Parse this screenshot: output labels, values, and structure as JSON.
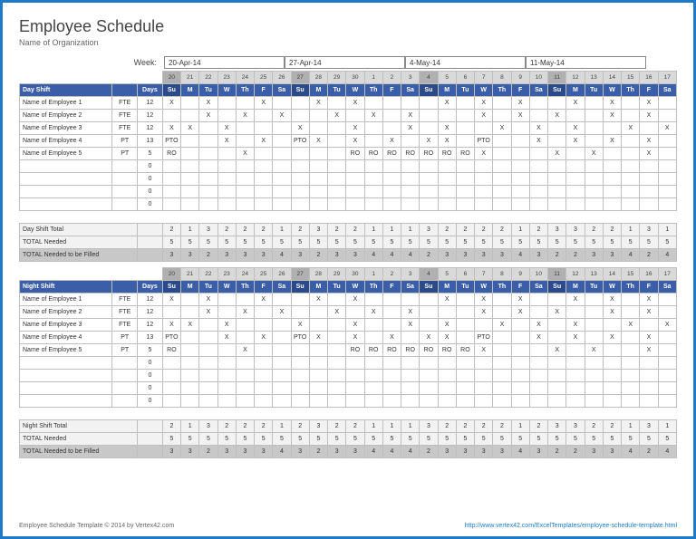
{
  "title": "Employee Schedule",
  "org": "Name of Organization",
  "weekLabel": "Week:",
  "weekStarts": [
    "20-Apr-14",
    "27-Apr-14",
    "4-May-14",
    "11-May-14"
  ],
  "daynums": [
    "20",
    "21",
    "22",
    "23",
    "24",
    "25",
    "26",
    "27",
    "28",
    "29",
    "30",
    "1",
    "2",
    "3",
    "4",
    "5",
    "6",
    "7",
    "8",
    "9",
    "10",
    "11",
    "12",
    "13",
    "14",
    "15",
    "16",
    "17"
  ],
  "dows": [
    "Su",
    "M",
    "Tu",
    "W",
    "Th",
    "F",
    "Sa",
    "Su",
    "M",
    "Tu",
    "W",
    "Th",
    "F",
    "Sa",
    "Su",
    "M",
    "Tu",
    "W",
    "Th",
    "F",
    "Sa",
    "Su",
    "M",
    "Tu",
    "W",
    "Th",
    "F",
    "Sa"
  ],
  "sundayIdx": [
    0,
    7,
    14,
    21
  ],
  "shifts": [
    {
      "name": "Day Shift",
      "daysLabel": "Days",
      "rows": [
        {
          "name": "Name of Employee 1",
          "type": "FTE",
          "days": "12",
          "cells": [
            "X",
            "",
            "X",
            "",
            "",
            "X",
            "",
            "",
            "X",
            "",
            "X",
            "",
            "",
            "",
            "",
            "X",
            "",
            "X",
            "",
            "X",
            "",
            "",
            "X",
            "",
            "X",
            "",
            "X",
            ""
          ]
        },
        {
          "name": "Name of Employee 2",
          "type": "FTE",
          "days": "12",
          "cells": [
            "",
            "",
            "X",
            "",
            "X",
            "",
            "X",
            "",
            "",
            "X",
            "",
            "X",
            "",
            "X",
            "",
            "",
            "",
            "X",
            "",
            "X",
            "",
            "X",
            "",
            "",
            "X",
            "",
            "X",
            ""
          ]
        },
        {
          "name": "Name of Employee 3",
          "type": "FTE",
          "days": "12",
          "cells": [
            "X",
            "X",
            "",
            "X",
            "",
            "",
            "",
            "X",
            "",
            "",
            "X",
            "",
            "",
            "X",
            "",
            "X",
            "",
            "",
            "X",
            "",
            "X",
            "",
            "X",
            "",
            "",
            "X",
            "",
            "X"
          ]
        },
        {
          "name": "Name of Employee 4",
          "type": "PT",
          "days": "13",
          "cells": [
            "PTO",
            "",
            "",
            "X",
            "",
            "X",
            "",
            "PTO",
            "X",
            "",
            "X",
            "",
            "X",
            "",
            "X",
            "X",
            "",
            "PTO",
            "",
            "",
            "X",
            "",
            "X",
            "",
            "X",
            "",
            "X",
            ""
          ]
        },
        {
          "name": "Name of Employee 5",
          "type": "PT",
          "days": "5",
          "cells": [
            "RO",
            "",
            "",
            "",
            "X",
            "",
            "",
            "",
            "",
            "",
            "RO",
            "RO",
            "RO",
            "RO",
            "RO",
            "RO",
            "RO",
            "X",
            "",
            "",
            "",
            "X",
            "",
            "X",
            "",
            "",
            "X",
            ""
          ]
        },
        {
          "name": "",
          "type": "",
          "days": "0",
          "cells": [
            "",
            "",
            "",
            "",
            "",
            "",
            "",
            "",
            "",
            "",
            "",
            "",
            "",
            "",
            "",
            "",
            "",
            "",
            "",
            "",
            "",
            "",
            "",
            "",
            "",
            "",
            "",
            ""
          ]
        },
        {
          "name": "",
          "type": "",
          "days": "0",
          "cells": [
            "",
            "",
            "",
            "",
            "",
            "",
            "",
            "",
            "",
            "",
            "",
            "",
            "",
            "",
            "",
            "",
            "",
            "",
            "",
            "",
            "",
            "",
            "",
            "",
            "",
            "",
            "",
            ""
          ]
        },
        {
          "name": "",
          "type": "",
          "days": "0",
          "cells": [
            "",
            "",
            "",
            "",
            "",
            "",
            "",
            "",
            "",
            "",
            "",
            "",
            "",
            "",
            "",
            "",
            "",
            "",
            "",
            "",
            "",
            "",
            "",
            "",
            "",
            "",
            "",
            ""
          ]
        },
        {
          "name": "",
          "type": "",
          "days": "0",
          "cells": [
            "",
            "",
            "",
            "",
            "",
            "",
            "",
            "",
            "",
            "",
            "",
            "",
            "",
            "",
            "",
            "",
            "",
            "",
            "",
            "",
            "",
            "",
            "",
            "",
            "",
            "",
            "",
            ""
          ]
        }
      ],
      "totals": [
        {
          "label": "Day Shift Total",
          "vals": [
            "2",
            "1",
            "3",
            "2",
            "2",
            "2",
            "1",
            "2",
            "3",
            "2",
            "2",
            "1",
            "1",
            "1",
            "3",
            "2",
            "2",
            "2",
            "2",
            "1",
            "2",
            "3",
            "3",
            "2",
            "2",
            "1",
            "3",
            "1"
          ]
        },
        {
          "label": "TOTAL Needed",
          "vals": [
            "5",
            "5",
            "5",
            "5",
            "5",
            "5",
            "5",
            "5",
            "5",
            "5",
            "5",
            "5",
            "5",
            "5",
            "5",
            "5",
            "5",
            "5",
            "5",
            "5",
            "5",
            "5",
            "5",
            "5",
            "5",
            "5",
            "5",
            "5"
          ]
        },
        {
          "label": "TOTAL Needed to be Filled",
          "vals": [
            "3",
            "3",
            "2",
            "3",
            "3",
            "3",
            "4",
            "3",
            "2",
            "3",
            "3",
            "4",
            "4",
            "4",
            "2",
            "3",
            "3",
            "3",
            "3",
            "4",
            "3",
            "2",
            "2",
            "3",
            "3",
            "4",
            "2",
            "4"
          ],
          "dark": true
        }
      ]
    },
    {
      "name": "Night Shift",
      "daysLabel": "Days",
      "rows": [
        {
          "name": "Name of Employee 1",
          "type": "FTE",
          "days": "12",
          "cells": [
            "X",
            "",
            "X",
            "",
            "",
            "X",
            "",
            "",
            "X",
            "",
            "X",
            "",
            "",
            "",
            "",
            "X",
            "",
            "X",
            "",
            "X",
            "",
            "",
            "X",
            "",
            "X",
            "",
            "X",
            ""
          ]
        },
        {
          "name": "Name of Employee 2",
          "type": "FTE",
          "days": "12",
          "cells": [
            "",
            "",
            "X",
            "",
            "X",
            "",
            "X",
            "",
            "",
            "X",
            "",
            "X",
            "",
            "X",
            "",
            "",
            "",
            "X",
            "",
            "X",
            "",
            "X",
            "",
            "",
            "X",
            "",
            "X",
            ""
          ]
        },
        {
          "name": "Name of Employee 3",
          "type": "FTE",
          "days": "12",
          "cells": [
            "X",
            "X",
            "",
            "X",
            "",
            "",
            "",
            "X",
            "",
            "",
            "X",
            "",
            "",
            "X",
            "",
            "X",
            "",
            "",
            "X",
            "",
            "X",
            "",
            "X",
            "",
            "",
            "X",
            "",
            "X"
          ]
        },
        {
          "name": "Name of Employee 4",
          "type": "PT",
          "days": "13",
          "cells": [
            "PTO",
            "",
            "",
            "X",
            "",
            "X",
            "",
            "PTO",
            "X",
            "",
            "X",
            "",
            "X",
            "",
            "X",
            "X",
            "",
            "PTO",
            "",
            "",
            "X",
            "",
            "X",
            "",
            "X",
            "",
            "X",
            ""
          ]
        },
        {
          "name": "Name of Employee 5",
          "type": "PT",
          "days": "5",
          "cells": [
            "RO",
            "",
            "",
            "",
            "X",
            "",
            "",
            "",
            "",
            "",
            "RO",
            "RO",
            "RO",
            "RO",
            "RO",
            "RO",
            "RO",
            "X",
            "",
            "",
            "",
            "X",
            "",
            "X",
            "",
            "",
            "X",
            ""
          ]
        },
        {
          "name": "",
          "type": "",
          "days": "0",
          "cells": [
            "",
            "",
            "",
            "",
            "",
            "",
            "",
            "",
            "",
            "",
            "",
            "",
            "",
            "",
            "",
            "",
            "",
            "",
            "",
            "",
            "",
            "",
            "",
            "",
            "",
            "",
            "",
            ""
          ]
        },
        {
          "name": "",
          "type": "",
          "days": "0",
          "cells": [
            "",
            "",
            "",
            "",
            "",
            "",
            "",
            "",
            "",
            "",
            "",
            "",
            "",
            "",
            "",
            "",
            "",
            "",
            "",
            "",
            "",
            "",
            "",
            "",
            "",
            "",
            "",
            ""
          ]
        },
        {
          "name": "",
          "type": "",
          "days": "0",
          "cells": [
            "",
            "",
            "",
            "",
            "",
            "",
            "",
            "",
            "",
            "",
            "",
            "",
            "",
            "",
            "",
            "",
            "",
            "",
            "",
            "",
            "",
            "",
            "",
            "",
            "",
            "",
            "",
            ""
          ]
        },
        {
          "name": "",
          "type": "",
          "days": "0",
          "cells": [
            "",
            "",
            "",
            "",
            "",
            "",
            "",
            "",
            "",
            "",
            "",
            "",
            "",
            "",
            "",
            "",
            "",
            "",
            "",
            "",
            "",
            "",
            "",
            "",
            "",
            "",
            "",
            ""
          ]
        }
      ],
      "totals": [
        {
          "label": "Night Shift Total",
          "vals": [
            "2",
            "1",
            "3",
            "2",
            "2",
            "2",
            "1",
            "2",
            "3",
            "2",
            "2",
            "1",
            "1",
            "1",
            "3",
            "2",
            "2",
            "2",
            "2",
            "1",
            "2",
            "3",
            "3",
            "2",
            "2",
            "1",
            "3",
            "1"
          ]
        },
        {
          "label": "TOTAL Needed",
          "vals": [
            "5",
            "5",
            "5",
            "5",
            "5",
            "5",
            "5",
            "5",
            "5",
            "5",
            "5",
            "5",
            "5",
            "5",
            "5",
            "5",
            "5",
            "5",
            "5",
            "5",
            "5",
            "5",
            "5",
            "5",
            "5",
            "5",
            "5",
            "5"
          ]
        },
        {
          "label": "TOTAL Needed to be Filled",
          "vals": [
            "3",
            "3",
            "2",
            "3",
            "3",
            "3",
            "4",
            "3",
            "2",
            "3",
            "3",
            "4",
            "4",
            "4",
            "2",
            "3",
            "3",
            "3",
            "3",
            "4",
            "3",
            "2",
            "2",
            "3",
            "3",
            "4",
            "2",
            "4"
          ],
          "dark": true
        }
      ]
    }
  ],
  "footer": {
    "left": "Employee Schedule Template © 2014 by Vertex42.com",
    "right": "http://www.vertex42.com/ExcelTemplates/employee-schedule-template.html"
  }
}
